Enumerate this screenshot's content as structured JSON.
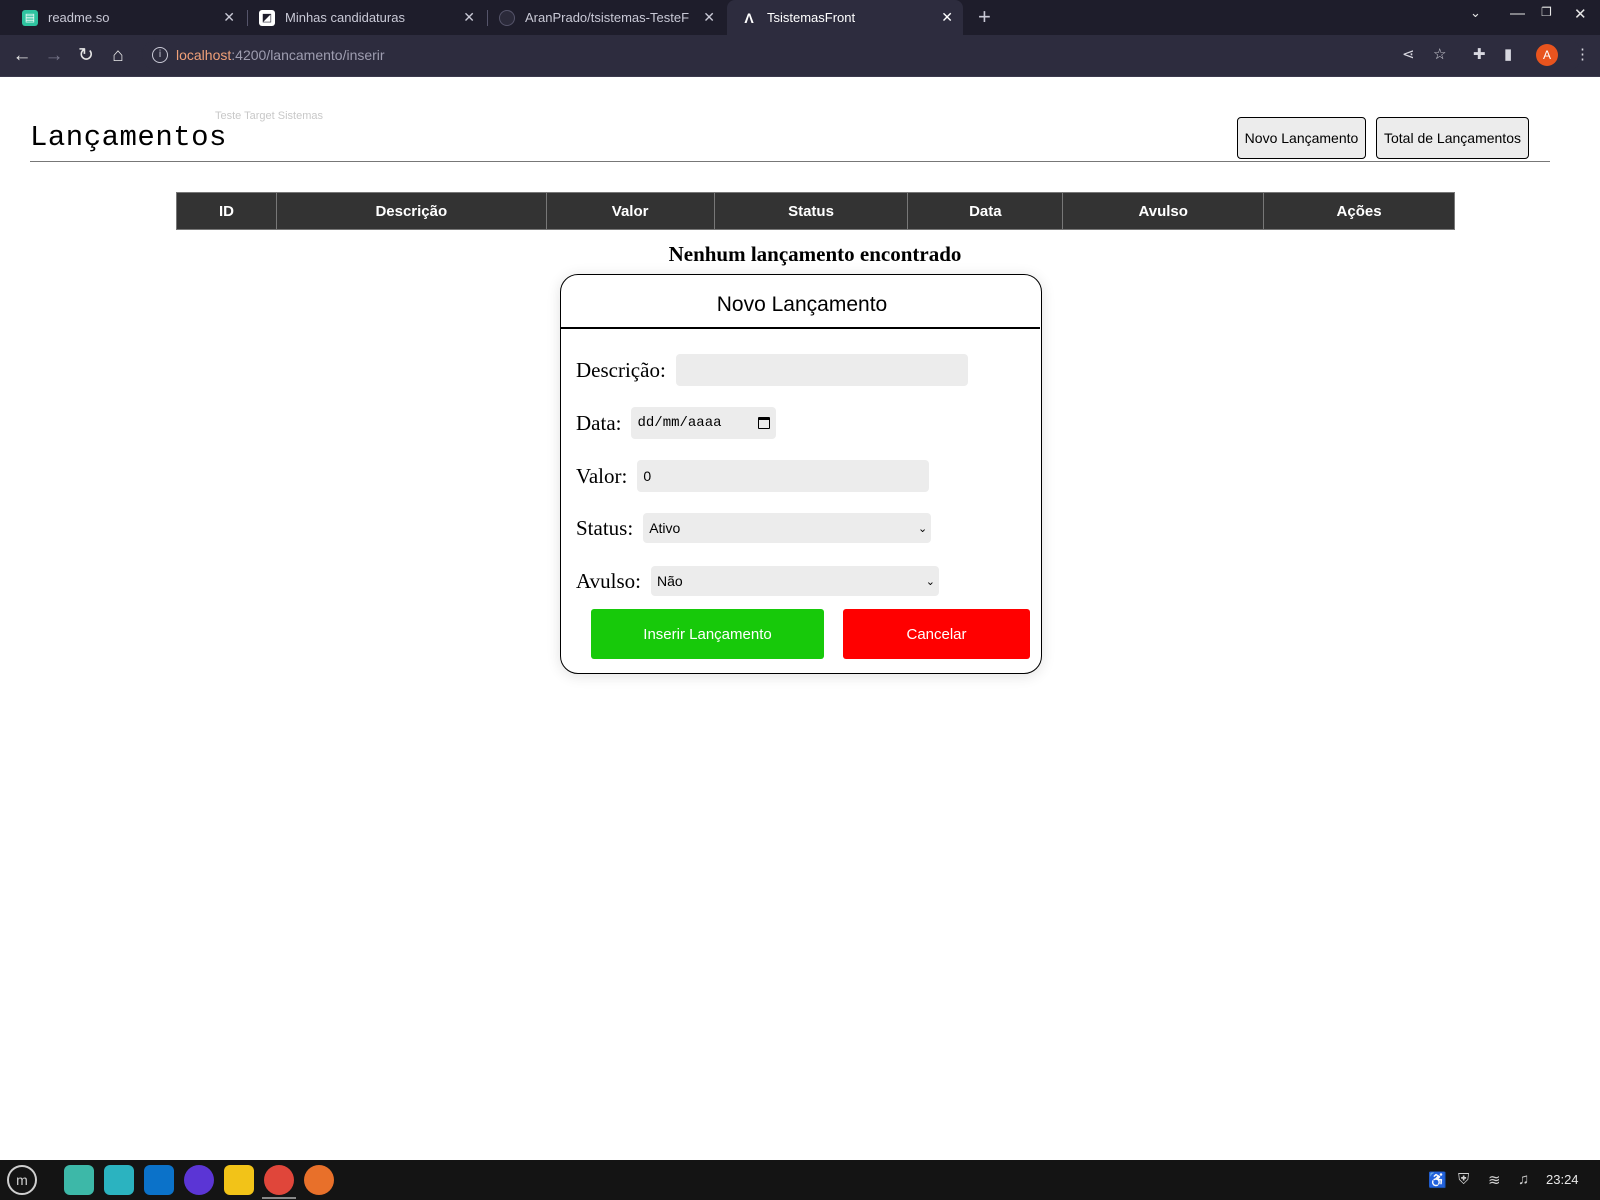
{
  "browser": {
    "tabs": [
      {
        "title": "readme.so",
        "icon": "readme-favicon"
      },
      {
        "title": "Minhas candidaturas",
        "icon": "gupy-favicon"
      },
      {
        "title": "AranPrado/tsistemas-TesteF",
        "icon": "github-favicon"
      },
      {
        "title": "TsistemasFront",
        "icon": "angular-favicon"
      }
    ],
    "url_host": "localhost",
    "url_path": ":4200/lancamento/inserir",
    "profile_initial": "A"
  },
  "page": {
    "brand": "Teste Target Sistemas",
    "title": "Lançamentos",
    "buttons": {
      "new": "Novo Lançamento",
      "total": "Total de Lançamentos"
    },
    "table_headers": [
      "ID",
      "Descrição",
      "Valor",
      "Status",
      "Data",
      "Avulso",
      "Ações"
    ],
    "empty_message": "Nenhum lançamento encontrado"
  },
  "modal": {
    "title": "Novo Lançamento",
    "descricao_label": "Descrição:",
    "descricao_value": "",
    "data_label": "Data:",
    "data_placeholder": "dd/mm/aaaa",
    "valor_label": "Valor:",
    "valor_value": "0",
    "status_label": "Status:",
    "status_value": "Ativo",
    "avulso_label": "Avulso:",
    "avulso_value": "Não",
    "insert_button": "Inserir Lançamento",
    "cancel_button": "Cancelar"
  },
  "taskbar": {
    "clock": "23:24"
  },
  "colors": {
    "insert": "#17c90a",
    "cancel": "#ff0000",
    "table_header": "#333333"
  }
}
